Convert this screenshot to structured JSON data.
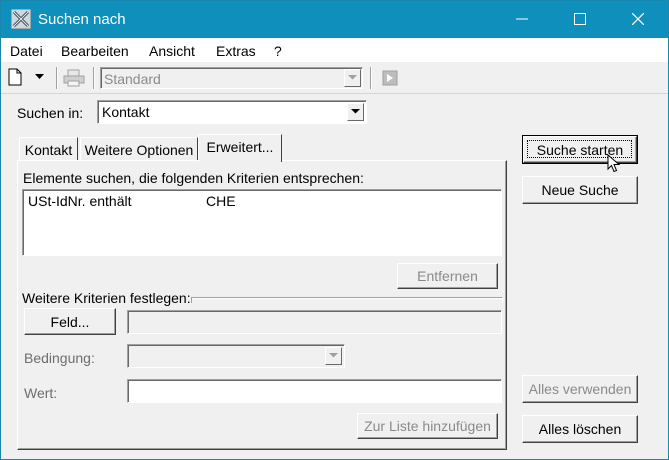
{
  "window": {
    "title": "Suchen nach"
  },
  "menu": {
    "items": [
      "Datei",
      "Bearbeiten",
      "Ansicht",
      "Extras",
      "?"
    ]
  },
  "toolbar": {
    "view_combo_value": "Standard"
  },
  "search_in": {
    "label": "Suchen in:",
    "value": "Kontakt"
  },
  "tabs": [
    {
      "label": "Kontakt"
    },
    {
      "label": "Weitere Optionen"
    },
    {
      "label": "Erweitert..."
    }
  ],
  "criteria": {
    "heading": "Elemente suchen, die folgenden Kriterien entsprechen:",
    "rows": [
      {
        "field": "USt-IdNr. enthält",
        "value": "CHE"
      }
    ],
    "remove_label": "Entfernen"
  },
  "more_criteria": {
    "label": "Weitere Kriterien festlegen:",
    "field_button": "Feld...",
    "condition_label": "Bedingung:",
    "value_label": "Wert:",
    "add_button": "Zur Liste hinzufügen"
  },
  "actions": {
    "start": "Suche starten",
    "new": "Neue Suche",
    "use_all": "Alles verwenden",
    "clear_all": "Alles löschen"
  }
}
